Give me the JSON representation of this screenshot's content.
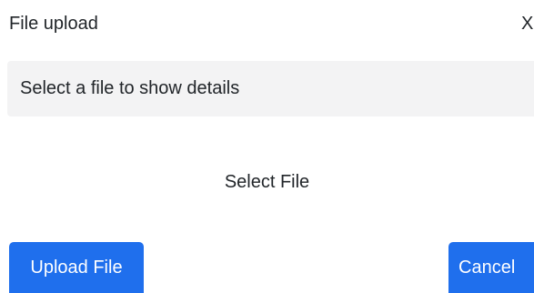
{
  "dialog": {
    "title": "File upload",
    "close_label": "X",
    "details_text": "Select a file to show details",
    "select_file_label": "Select File",
    "upload_button_label": "Upload File",
    "cancel_button_label": "Cancel"
  },
  "colors": {
    "primary": "#1f6fed",
    "panel_background": "#f3f3f4",
    "text": "#212529"
  }
}
